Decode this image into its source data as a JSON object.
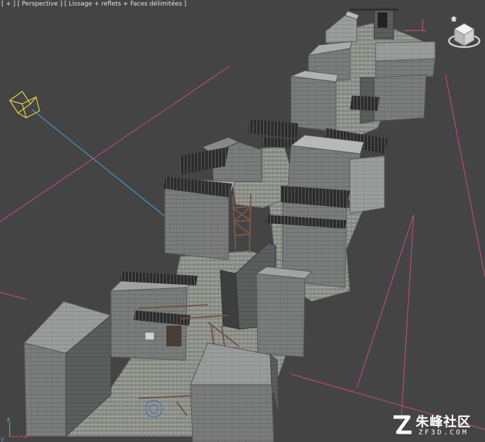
{
  "viewport": {
    "label_parts": [
      "[ + ]",
      "[ Perspective ]",
      "[ Lissage + reflets + Faces délimitées ]"
    ],
    "background": "#444444",
    "accent_colors": {
      "frustum": "#e85a9a",
      "camera": "#e6d64a",
      "target_line": "#4aa6e6"
    }
  },
  "axis": {
    "x": "x",
    "y": "y",
    "z": "z"
  },
  "viewcube": {
    "icon": "viewcube-icon",
    "home_icon": "home-icon"
  },
  "watermark": {
    "logo": "zf3d-logo",
    "cn": "朱峰社区",
    "en": "ZF3D.COM"
  }
}
